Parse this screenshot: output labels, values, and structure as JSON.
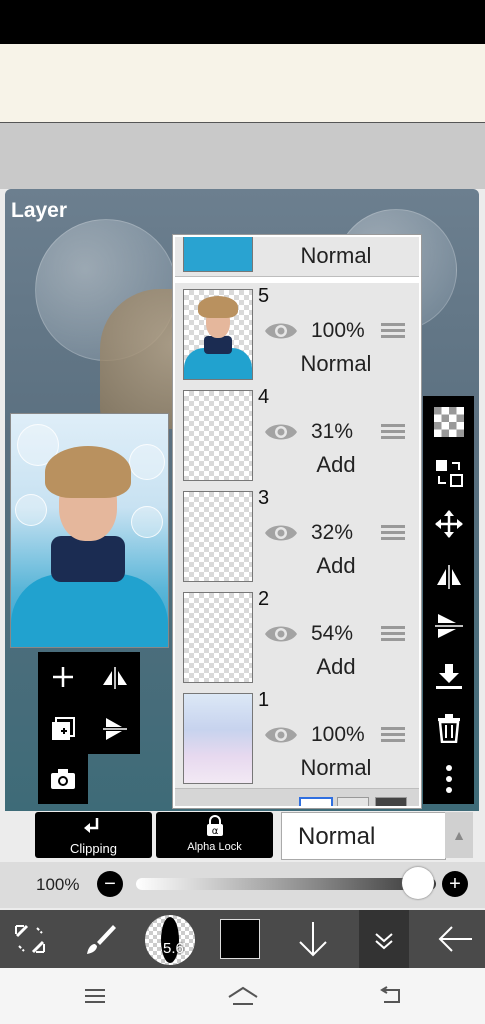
{
  "panel": {
    "title": "Layer"
  },
  "layers": [
    {
      "number": "",
      "opacity": "",
      "blend": "Normal"
    },
    {
      "number": "5",
      "opacity": "100%",
      "blend": "Normal"
    },
    {
      "number": "4",
      "opacity": "31%",
      "blend": "Add"
    },
    {
      "number": "3",
      "opacity": "32%",
      "blend": "Add"
    },
    {
      "number": "2",
      "opacity": "54%",
      "blend": "Add"
    },
    {
      "number": "1",
      "opacity": "100%",
      "blend": "Normal"
    }
  ],
  "buttons": {
    "clipping": "Clipping",
    "alpha_lock": "Alpha Lock"
  },
  "blend_mode": {
    "selected": "Normal"
  },
  "opacity_slider": {
    "label": "100%",
    "value_percent": 100
  },
  "brush": {
    "size": "5.6"
  },
  "colors": {
    "primary": "#000000"
  },
  "icons": {
    "toolpad": [
      "plus-icon",
      "flip-horizontal-icon",
      "duplicate-icon",
      "flip-vertical-icon",
      "camera-icon"
    ],
    "right_tools": [
      "checker-icon",
      "transform-layers-icon",
      "move-icon",
      "flip-horizontal-icon",
      "flip-vertical-icon",
      "merge-down-icon",
      "trash-icon",
      "more-icon"
    ],
    "bottom": [
      "selection-icon",
      "brush-icon",
      "brush-size-icon",
      "color-icon",
      "down-arrow-icon",
      "layers-icon",
      "back-arrow-icon"
    ],
    "nav": [
      "menu-icon",
      "home-icon",
      "back-icon"
    ]
  }
}
